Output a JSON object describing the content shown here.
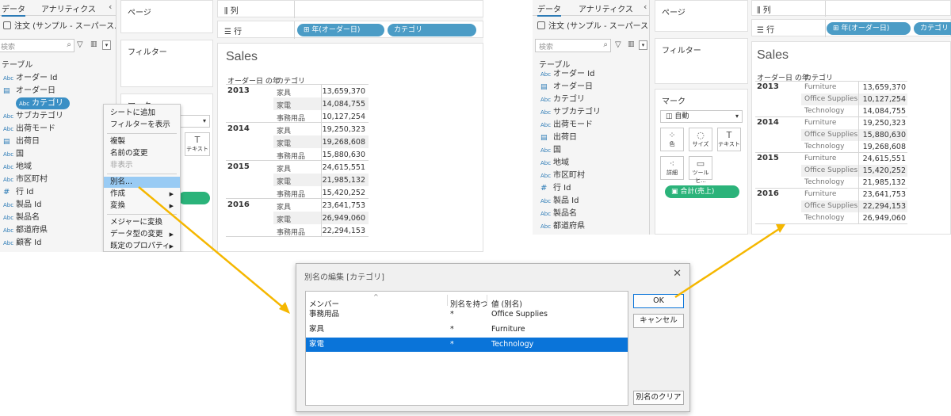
{
  "panel_common": {
    "tab_data": "データ",
    "tab_analytics": "アナリティクス",
    "collapse_icon": "chevron-left-icon",
    "datasource": "注文 (サンプル - スーパース...",
    "search_placeholder": "検索",
    "tables_label": "テーブル",
    "pages_label": "ページ",
    "filters_label": "フィルター",
    "marks_label": "マーク",
    "columns_label": "列",
    "rows_label": "行",
    "row_pill_year": "⊞ 年(オーダー日)",
    "row_pill_category": "カテゴリ",
    "sheet_title": "Sales",
    "hdr_year": "オーダー日 の年",
    "hdr_category": "カテゴリ"
  },
  "left_fields": [
    {
      "icon": "Abc",
      "name": "オーダー Id"
    },
    {
      "icon": "cal",
      "name": "オーダー日"
    },
    {
      "icon": "Abc",
      "name": "カテゴリ",
      "selected": true
    },
    {
      "icon": "Abc",
      "name": "サブカテゴリ"
    },
    {
      "icon": "Abc",
      "name": "出荷モード"
    },
    {
      "icon": "cal",
      "name": "出荷日"
    },
    {
      "icon": "Abc",
      "name": "国"
    },
    {
      "icon": "Abc",
      "name": "地域"
    },
    {
      "icon": "Abc",
      "name": "市区町村"
    },
    {
      "icon": "#",
      "name": "行 Id"
    },
    {
      "icon": "Abc",
      "name": "製品 Id"
    },
    {
      "icon": "Abc",
      "name": "製品名"
    },
    {
      "icon": "Abc",
      "name": "都道府県"
    },
    {
      "icon": "Abc",
      "name": "顧客 Id"
    }
  ],
  "right_fields": [
    {
      "icon": "Abc",
      "name": "オーダー Id"
    },
    {
      "icon": "cal",
      "name": "オーダー日"
    },
    {
      "icon": "Abc",
      "name": "カテゴリ"
    },
    {
      "icon": "Abc",
      "name": "サブカテゴリ"
    },
    {
      "icon": "Abc",
      "name": "出荷モード"
    },
    {
      "icon": "cal",
      "name": "出荷日"
    },
    {
      "icon": "Abc",
      "name": "国"
    },
    {
      "icon": "Abc",
      "name": "地域"
    },
    {
      "icon": "Abc",
      "name": "市区町村"
    },
    {
      "icon": "#",
      "name": "行 Id"
    },
    {
      "icon": "Abc",
      "name": "製品 Id"
    },
    {
      "icon": "Abc",
      "name": "製品名"
    },
    {
      "icon": "Abc",
      "name": "都道府県"
    }
  ],
  "context_menu": [
    {
      "label": "シートに追加"
    },
    {
      "label": "フィルターを表示"
    },
    {
      "sep": true
    },
    {
      "label": "複製"
    },
    {
      "label": "名前の変更"
    },
    {
      "label": "非表示",
      "disabled": true
    },
    {
      "sep": true
    },
    {
      "label": "別名...",
      "highlighted": true
    },
    {
      "label": "作成",
      "submenu": true
    },
    {
      "label": "変換",
      "submenu": true
    },
    {
      "sep": true
    },
    {
      "label": "メジャーに変換"
    },
    {
      "label": "データ型の変更",
      "submenu": true
    },
    {
      "label": "既定のプロパティ",
      "submenu": true
    }
  ],
  "left_text_button": "テキスト",
  "left_table": {
    "years": [
      "2013",
      "2014",
      "2015",
      "2016"
    ],
    "categories": [
      "家具",
      "家電",
      "事務用品"
    ],
    "values": [
      [
        "13,659,370",
        "14,084,755",
        "10,127,254"
      ],
      [
        "19,250,323",
        "19,268,608",
        "15,880,630"
      ],
      [
        "24,615,551",
        "21,985,132",
        "15,420,252"
      ],
      [
        "23,641,753",
        "26,949,060",
        "22,294,153"
      ]
    ]
  },
  "right_table": {
    "years": [
      "2013",
      "2014",
      "2015",
      "2016"
    ],
    "rows": [
      [
        [
          "Furniture",
          "13,659,370"
        ],
        [
          "Office Supplies",
          "10,127,254"
        ],
        [
          "Technology",
          "14,084,755"
        ]
      ],
      [
        [
          "Furniture",
          "19,250,323"
        ],
        [
          "Office Supplies",
          "15,880,630"
        ],
        [
          "Technology",
          "19,268,608"
        ]
      ],
      [
        [
          "Furniture",
          "24,615,551"
        ],
        [
          "Office Supplies",
          "15,420,252"
        ],
        [
          "Technology",
          "21,985,132"
        ]
      ],
      [
        [
          "Furniture",
          "23,641,753"
        ],
        [
          "Office Supplies",
          "22,294,153"
        ],
        [
          "Technology",
          "26,949,060"
        ]
      ]
    ]
  },
  "right_marks": {
    "type": "自動",
    "buttons": [
      "色",
      "サイズ",
      "テキスト",
      "詳細",
      "ツールヒ..."
    ],
    "pill": "合計(売上)"
  },
  "dialog": {
    "title": "別名の編集 [カテゴリ]",
    "col_member": "メンバー",
    "col_has_alias": "別名を持つ",
    "col_value": "値 (別名)",
    "rows": [
      {
        "member": "事務用品",
        "has": "*",
        "alias": "Office Supplies"
      },
      {
        "member": "家具",
        "has": "*",
        "alias": "Furniture"
      },
      {
        "member": "家電",
        "has": "*",
        "alias": "Technology",
        "selected": true
      }
    ],
    "ok": "OK",
    "cancel": "キャンセル",
    "clear": "別名のクリア"
  },
  "colors": {
    "pill_blue": "#4b9cc6",
    "pill_green": "#2bb37a",
    "selection_blue": "#0a74d9",
    "menu_highlight": "#99cbf4",
    "arrow_yellow": "#f5b700"
  }
}
